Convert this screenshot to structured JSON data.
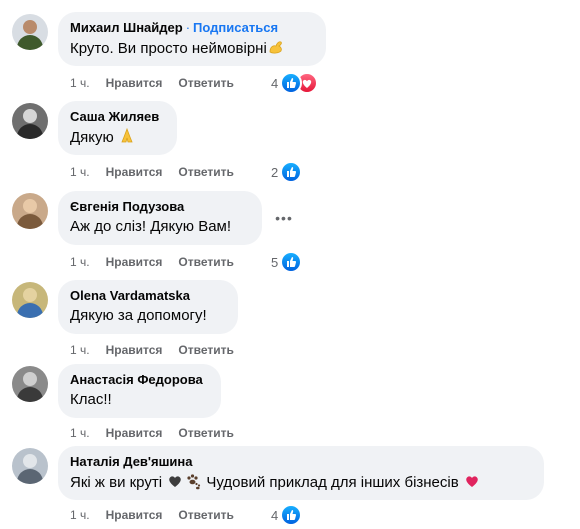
{
  "comments": [
    {
      "author": "Михаил Шнайдер",
      "separator": "·",
      "follow_label": "Подписаться",
      "text": "Круто. Ви просто неймовірні",
      "time": "1 ч.",
      "like_label": "Нравится",
      "reply_label": "Ответить",
      "reaction_count": "4",
      "reactions": [
        "like-icon",
        "love-icon"
      ],
      "trailing_emoji": "flexed-biceps-icon"
    },
    {
      "author": "Саша Жиляев",
      "text": "Дякую",
      "time": "1 ч.",
      "like_label": "Нравится",
      "reply_label": "Ответить",
      "reaction_count": "2",
      "reactions": [
        "like-icon"
      ],
      "trailing_emoji": "folded-hands-icon"
    },
    {
      "author": "Євгенія Подузова",
      "text": "Аж до сліз! Дякую Вам!",
      "time": "1 ч.",
      "like_label": "Нравится",
      "reply_label": "Ответить",
      "reaction_count": "5",
      "reactions": [
        "like-icon"
      ]
    },
    {
      "author": "Olena Vardamatska",
      "text": "Дякую за допомогу!",
      "time": "1 ч.",
      "like_label": "Нравится",
      "reply_label": "Ответить"
    },
    {
      "author": "Анастасія Федорова",
      "text": "Клас!!",
      "time": "1 ч.",
      "like_label": "Нравится",
      "reply_label": "Ответить"
    },
    {
      "author": "Наталія Дев'яшина",
      "text_before": "Які ж ви круті",
      "text_after": "Чудовий приклад для інших бізнесів",
      "time": "1 ч.",
      "like_label": "Нравится",
      "reply_label": "Ответить",
      "reaction_count": "4",
      "reactions": [
        "like-icon"
      ]
    }
  ],
  "colors": {
    "bubble": "#f0f2f5",
    "link": "#1877f2",
    "meta": "#65676b",
    "like": "#1877f2",
    "love": "#f33e58"
  }
}
